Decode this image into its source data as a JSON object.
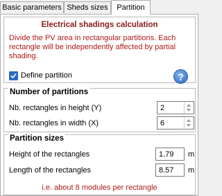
{
  "tabs": [
    {
      "label": "Basic parameters"
    },
    {
      "label": "Sheds sizes"
    },
    {
      "label": "Partition"
    }
  ],
  "calc": {
    "title": "Electrical shadings calculation",
    "description": "Divide the PV area in rectangular partitions. Each rectangle will be independently affected by partial shading.",
    "define_partition_label": "Define partition",
    "define_partition_checked": true,
    "help_glyph": "?"
  },
  "partitions": {
    "title": "Number of partitions",
    "height_label": "Nb. rectangles in height (Y)",
    "height_value": "2",
    "width_label": "Nb. rectangles in width (X)",
    "width_value": "6"
  },
  "sizes": {
    "title": "Partition sizes",
    "height_label": "Height of the rectangles",
    "height_value": "1.79",
    "height_unit": "m",
    "length_label": "Length of the rectangles",
    "length_value": "8.57",
    "length_unit": "m",
    "note": "i.e. about 8 modules per rectangle"
  },
  "icons": {
    "checkbox": "checkmark-icon",
    "help": "help-icon"
  },
  "colors": {
    "accent_red": "#b01919",
    "title_red": "#8c1a1a",
    "checkbox_blue": "#2a6ac0"
  }
}
